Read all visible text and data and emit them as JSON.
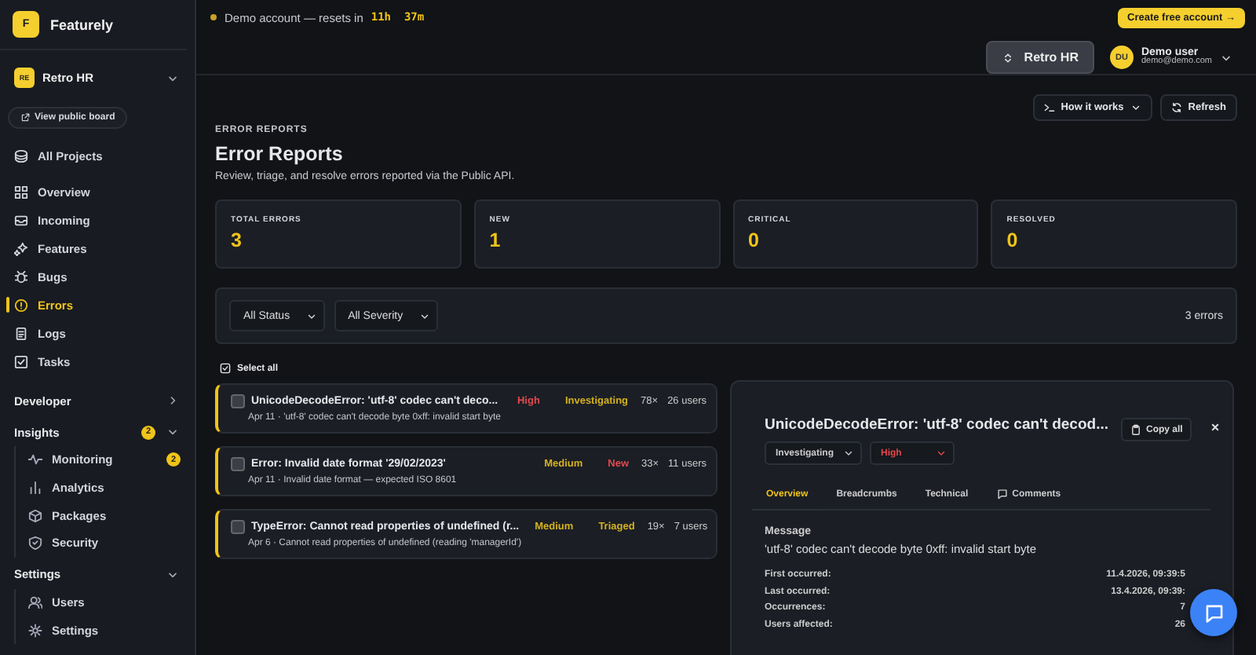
{
  "brand": {
    "logo": "F",
    "name": "Featurely"
  },
  "project": {
    "badge": "RE",
    "name": "Retro HR"
  },
  "public_board": "View public board",
  "nav": [
    {
      "label": "All Projects",
      "selected": false
    },
    {
      "label": "Overview",
      "selected": false
    },
    {
      "label": "Incoming",
      "selected": false
    },
    {
      "label": "Features",
      "selected": false
    },
    {
      "label": "Bugs",
      "selected": false
    },
    {
      "label": "Errors",
      "selected": true
    },
    {
      "label": "Logs",
      "selected": false
    },
    {
      "label": "Tasks",
      "selected": false
    }
  ],
  "sections": [
    {
      "label": "Developer",
      "expanded": false
    },
    {
      "label": "Insights",
      "expanded": true,
      "badge": "2",
      "children": [
        {
          "label": "Monitoring",
          "badge": "2"
        },
        {
          "label": "Analytics"
        },
        {
          "label": "Packages"
        },
        {
          "label": "Security"
        }
      ]
    },
    {
      "label": "Settings",
      "expanded": true,
      "children": [
        {
          "label": "Users"
        },
        {
          "label": "Settings"
        }
      ]
    }
  ],
  "banner": {
    "text": "Demo account — resets in",
    "countdown": "11h  37m",
    "cta": "Create free account →"
  },
  "project_switcher": "Retro HR",
  "user": {
    "initials": "DU",
    "name": "Demo user",
    "email": "demo@demo.com"
  },
  "header": {
    "buttons": [
      "How it works",
      "Refresh"
    ],
    "eyebrow": "ERROR REPORTS",
    "title": "Error Reports",
    "subtitle": "Review, triage, and resolve errors reported via the Public API."
  },
  "stats": [
    {
      "label": "TOTAL ERRORS",
      "value": "3"
    },
    {
      "label": "NEW",
      "value": "1"
    },
    {
      "label": "CRITICAL",
      "value": "0"
    },
    {
      "label": "RESOLVED",
      "value": "0"
    }
  ],
  "filters": [
    "All Status",
    "All Severity"
  ],
  "count": "3 errors",
  "select_all": "Select all",
  "errors": [
    {
      "title": "UnicodeDecodeError: 'utf-8' codec can't deco...",
      "meta": "Apr 11 · 'utf-8' codec can't decode byte 0xff: invalid start byte",
      "severity": {
        "label": "High",
        "color": "#e5484d"
      },
      "status": {
        "label": "Investigating",
        "color": "#d4b21f"
      },
      "count": "78×",
      "users": "26 users",
      "checked": false
    },
    {
      "title": "Error: Invalid date format '29/02/2023'",
      "meta": "Apr 11 · Invalid date format — expected ISO 8601",
      "severity": {
        "label": "Medium",
        "color": "#d4b21f"
      },
      "status": {
        "label": "New",
        "color": "#e5484d"
      },
      "count": "33×",
      "users": "11 users",
      "checked": false
    },
    {
      "title": "TypeError: Cannot read properties of undefined (r...",
      "meta": "Apr 6 · Cannot read properties of undefined (reading 'managerId')",
      "severity": {
        "label": "Medium",
        "color": "#d4b21f"
      },
      "status": {
        "label": "Triaged",
        "color": "#d4b21f"
      },
      "count": "19×",
      "users": "7 users",
      "checked": false
    }
  ],
  "detail": {
    "title": "UnicodeDecodeError: 'utf-8' codec can't decod...",
    "status": "Investigating",
    "severity": {
      "label": "High",
      "color": "#e5484d"
    },
    "copy": "Copy all",
    "close": "×",
    "tabs": [
      {
        "label": "Overview",
        "selected": true
      },
      {
        "label": "Breadcrumbs",
        "selected": false
      },
      {
        "label": "Technical",
        "selected": false
      },
      {
        "label": "Comments",
        "selected": false
      }
    ],
    "message_label": "Message",
    "message": "'utf-8' codec can't decode byte 0xff: invalid start byte",
    "facts": [
      {
        "label": "First occurred:",
        "value": "11.4.2026, 09:39:5"
      },
      {
        "label": "Last occurred:",
        "value": "13.4.2026, 09:39:"
      },
      {
        "label": "Occurrences:",
        "value": "7"
      },
      {
        "label": "Users affected:",
        "value": "26"
      }
    ]
  }
}
